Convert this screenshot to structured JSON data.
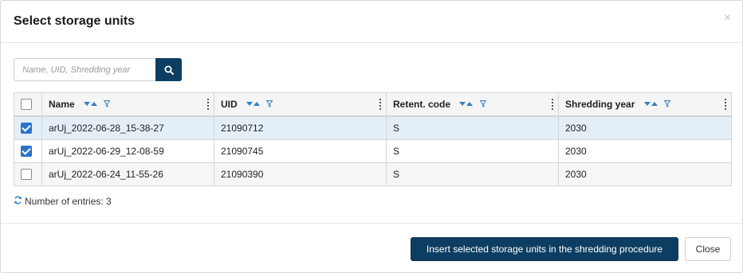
{
  "dialog": {
    "title": "Select storage units",
    "close_glyph": "×"
  },
  "search": {
    "placeholder": "Name, UID, Shredding year",
    "value": "",
    "button_icon": "search-icon"
  },
  "table": {
    "columns": [
      {
        "key": "select",
        "label": ""
      },
      {
        "key": "name",
        "label": "Name"
      },
      {
        "key": "uid",
        "label": "UID"
      },
      {
        "key": "retention_code",
        "label": "Retent. code"
      },
      {
        "key": "shredding_year",
        "label": "Shredding year"
      }
    ],
    "rows": [
      {
        "checked": true,
        "name": "arUj_2022-06-28_15-38-27",
        "uid": "21090712",
        "retention_code": "S",
        "shredding_year": "2030"
      },
      {
        "checked": true,
        "name": "arUj_2022-06-29_12-08-59",
        "uid": "21090745",
        "retention_code": "S",
        "shredding_year": "2030"
      },
      {
        "checked": false,
        "name": "arUj_2022-06-24_11-55-26",
        "uid": "21090390",
        "retention_code": "S",
        "shredding_year": "2030"
      }
    ]
  },
  "entries": {
    "label": "Number of entries: 3"
  },
  "footer": {
    "insert_label": "Insert selected storage units in the shredding procedure",
    "close_label": "Close"
  },
  "colors": {
    "primary": "#0d3e62",
    "selected_row": "#e4eef7",
    "checkbox_checked": "#2b74c8",
    "sort_icon": "#2f7fc6"
  }
}
